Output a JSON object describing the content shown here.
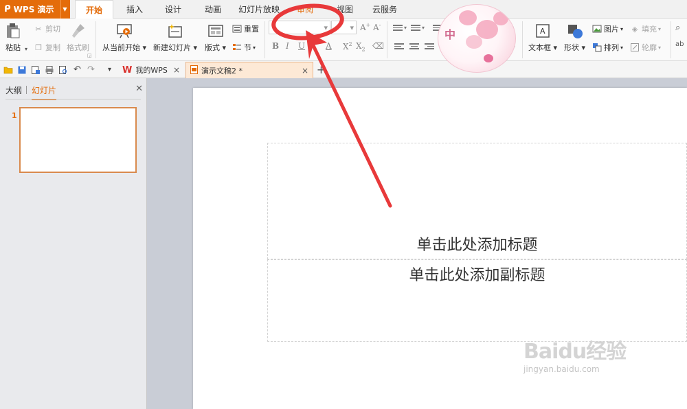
{
  "app": {
    "name": "WPS 演示",
    "brand_color": "#e46c0a"
  },
  "menu_tabs": [
    "开始",
    "插入",
    "设计",
    "动画",
    "幻灯片放映",
    "审阅",
    "视图",
    "云服务"
  ],
  "ribbon": {
    "paste": "粘贴",
    "cut": "剪切",
    "copy": "复制",
    "format_painter": "格式刷",
    "from_current": "从当前开始",
    "new_slide": "新建幻灯片",
    "layout": "版式",
    "reset": "重置",
    "section": "节",
    "text_box": "文本框",
    "shape": "形状",
    "picture": "图片",
    "fill": "填充",
    "arrange": "排列",
    "outline": "轮廓"
  },
  "doc_tabs": [
    {
      "label": "我的WPS"
    },
    {
      "label": "演示文稿2 *"
    }
  ],
  "panel": {
    "outline_tab": "大纲",
    "slides_tab": "幻灯片",
    "slide_number": "1"
  },
  "slide": {
    "title_placeholder": "单击此处添加标题",
    "subtitle_placeholder": "单击此处添加副标题"
  },
  "overlay": {
    "badge_char": "中",
    "watermark_logo": "Baidu经验",
    "watermark_url": "jingyan.baidu.com",
    "annotation_color": "#e8393a"
  }
}
